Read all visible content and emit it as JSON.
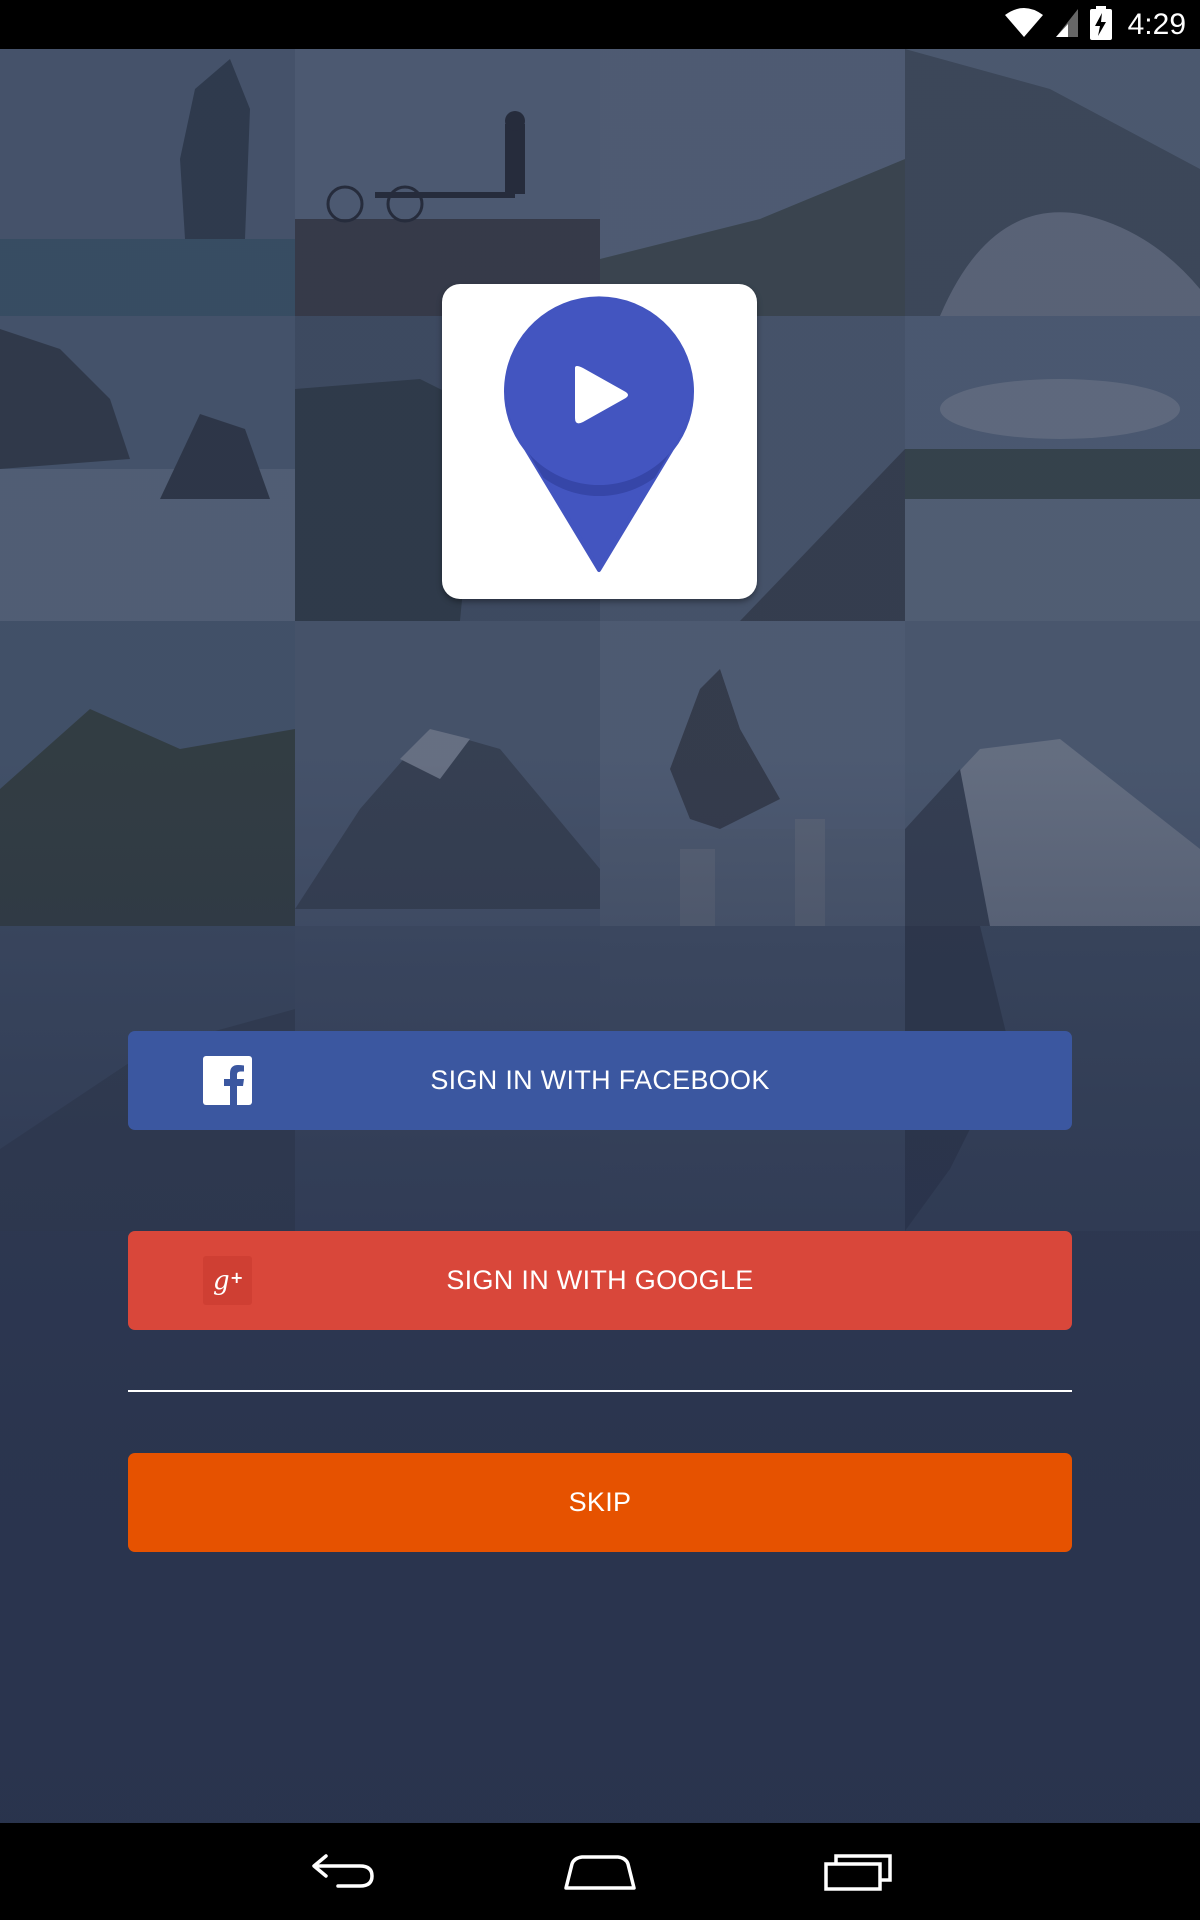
{
  "status_bar": {
    "time": "4:29",
    "icons": [
      "wifi-icon",
      "cellular-signal-icon",
      "battery-charging-icon"
    ]
  },
  "background": {
    "description_tiles": 16
  },
  "logo": {
    "icon": "location-pin-play-icon",
    "colors": {
      "pin": "#4355c0",
      "pin_shadow": "#3646a8",
      "play": "#ffffff"
    }
  },
  "buttons": {
    "facebook": {
      "label": "SIGN IN WITH FACEBOOK",
      "icon": "facebook-icon",
      "color": "#3b57a0"
    },
    "google": {
      "label": "SIGN IN WITH GOOGLE",
      "icon": "google-plus-icon",
      "color": "#d9473a"
    },
    "skip": {
      "label": "SKIP",
      "color": "#e65200"
    }
  },
  "nav_bar": {
    "items": [
      "back-icon",
      "home-icon",
      "recents-icon"
    ]
  }
}
